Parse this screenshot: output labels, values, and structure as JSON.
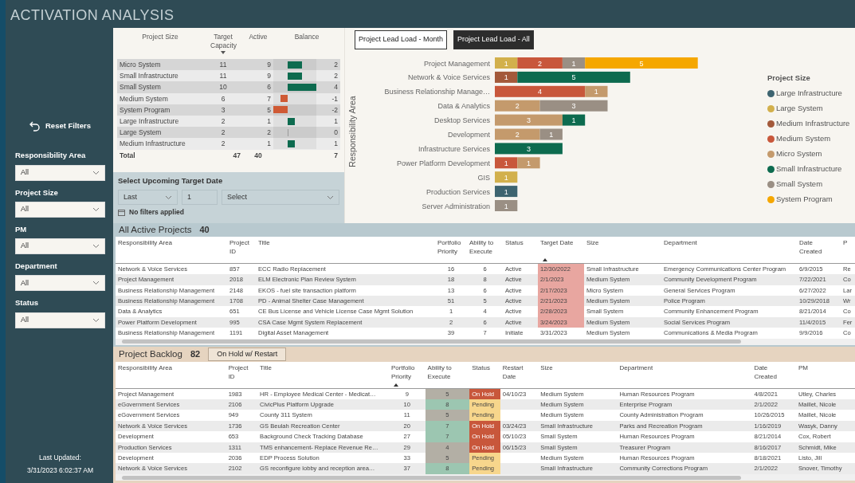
{
  "title": "ACTIVATION ANALYSIS",
  "sidebar": {
    "reset_label": "Reset Filters",
    "filters": [
      {
        "label": "Responsibility Area",
        "value": "All"
      },
      {
        "label": "Project Size",
        "value": "All"
      },
      {
        "label": "PM",
        "value": "All"
      },
      {
        "label": "Department",
        "value": "All"
      },
      {
        "label": "Status",
        "value": "All"
      }
    ],
    "last_updated_label": "Last Updated:",
    "last_updated": "3/31/2023 6:02:37 AM"
  },
  "capacity_table": {
    "columns": [
      {
        "label": "Project Size",
        "sorted": false
      },
      {
        "label": "Target Capacity",
        "sorted": true
      },
      {
        "label": "Active",
        "sorted": false
      },
      {
        "label": "Balance",
        "sorted": false
      }
    ],
    "rows": [
      {
        "size": "Micro System",
        "target": "11",
        "active": "9",
        "balance": "2",
        "kind": "surplus",
        "level": 0.5
      },
      {
        "size": "Small Infrastructure",
        "target": "11",
        "active": "9",
        "balance": "2",
        "kind": "surplus",
        "level": 0.5
      },
      {
        "size": "Small System",
        "target": "10",
        "active": "6",
        "balance": "4",
        "kind": "surplus",
        "level": 1
      },
      {
        "size": "Medium System",
        "target": "6",
        "active": "7",
        "balance": "-1",
        "kind": "deficit",
        "level": 0.5
      },
      {
        "size": "System Program",
        "target": "3",
        "active": "5",
        "balance": "-2",
        "kind": "deficit",
        "level": 1
      },
      {
        "size": "Large Infrastructure",
        "target": "2",
        "active": "1",
        "balance": "1",
        "kind": "surplus",
        "level": 0.25
      },
      {
        "size": "Large System",
        "target": "2",
        "active": "2",
        "balance": "0",
        "kind": "surplus",
        "level": 0
      },
      {
        "size": "Medium Infrastructure",
        "target": "2",
        "active": "1",
        "balance": "1",
        "kind": "surplus",
        "level": 0.25
      }
    ],
    "total": {
      "label": "Total",
      "target": "47",
      "active": "40",
      "balance": "7"
    }
  },
  "date_filter": {
    "title": "Select Upcoming Target Date",
    "period": "Last",
    "count": "1",
    "unit": "Select",
    "status": "No filters applied"
  },
  "chart_panel": {
    "tabs": [
      {
        "label": "Project Lead Load - Month",
        "selected": false
      },
      {
        "label": "Project Lead Load - All",
        "selected": true
      }
    ],
    "legend_title": "Project Size",
    "chart_data": {
      "type": "bar",
      "orientation": "horizontal",
      "stacked": true,
      "data_labels": true,
      "ylabel": "Responsibility Area",
      "categories": [
        "Project Management",
        "Network & Voice Services",
        "Business Relationship Manage…",
        "Data & Analytics",
        "Desktop Services",
        "Development",
        "Infrastructure Services",
        "Power Platform Development",
        "GIS",
        "Production Services",
        "Server Administration"
      ],
      "series": [
        {
          "name": "Large Infrastructure",
          "color": "#3d6470",
          "values": [
            null,
            null,
            null,
            null,
            null,
            null,
            null,
            null,
            null,
            1,
            null
          ]
        },
        {
          "name": "Large System",
          "color": "#d2b04c",
          "values": [
            1,
            null,
            null,
            null,
            null,
            null,
            null,
            null,
            1,
            null,
            null
          ]
        },
        {
          "name": "Medium Infrastructure",
          "color": "#a3593a",
          "values": [
            null,
            1,
            null,
            null,
            null,
            null,
            null,
            null,
            null,
            null,
            null
          ]
        },
        {
          "name": "Medium System",
          "color": "#c8573b",
          "values": [
            2,
            null,
            4,
            null,
            null,
            null,
            null,
            1,
            null,
            null,
            null
          ]
        },
        {
          "name": "Micro System",
          "color": "#c49a6c",
          "values": [
            null,
            null,
            1,
            2,
            3,
            2,
            null,
            1,
            null,
            null,
            null
          ]
        },
        {
          "name": "Small Infrastructure",
          "color": "#0d6b4f",
          "values": [
            null,
            5,
            null,
            null,
            1,
            null,
            3,
            null,
            null,
            null,
            null
          ]
        },
        {
          "name": "Small System",
          "color": "#9a8f84",
          "values": [
            1,
            null,
            null,
            3,
            null,
            1,
            null,
            null,
            null,
            null,
            1
          ]
        },
        {
          "name": "System Program",
          "color": "#f5a700",
          "values": [
            5,
            null,
            null,
            null,
            null,
            null,
            null,
            null,
            null,
            null,
            null
          ]
        }
      ]
    }
  },
  "active_projects": {
    "title": "All Active Projects",
    "count": "40",
    "columns": [
      {
        "label": "Responsibility Area",
        "sorted": false
      },
      {
        "label": "Project ID",
        "sorted": false
      },
      {
        "label": "Title",
        "sorted": false
      },
      {
        "label": "Portfolio Priority",
        "sorted": false
      },
      {
        "label": "Ability to Execute",
        "sorted": false
      },
      {
        "label": "Status",
        "sorted": false
      },
      {
        "label": "Target Date",
        "sorted": true
      },
      {
        "label": "Size",
        "sorted": false
      },
      {
        "label": "Department",
        "sorted": false
      },
      {
        "label": "Date Created",
        "sorted": false
      },
      {
        "label": "P",
        "sorted": false
      }
    ],
    "rows": [
      {
        "overdue": true,
        "cells": [
          "Network & Voice Services",
          "857",
          "ECC Radio Replacement",
          "16",
          "6",
          "Active",
          "12/30/2022",
          "Small Infrastructure",
          "Emergency Communications Center Program",
          "6/9/2015",
          "Re"
        ]
      },
      {
        "overdue": true,
        "cells": [
          "Project Management",
          "2018",
          "ELM Electronic Plan Review System",
          "18",
          "8",
          "Active",
          "2/1/2023",
          "Medium System",
          "Community Development Program",
          "7/22/2021",
          "Co"
        ]
      },
      {
        "overdue": true,
        "cells": [
          "Business Relationship Management",
          "2148",
          "EKOS - fuel site transaction platform",
          "13",
          "6",
          "Active",
          "2/17/2023",
          "Micro System",
          "General Services Program",
          "6/27/2022",
          "Lar"
        ]
      },
      {
        "overdue": true,
        "cells": [
          "Business Relationship Management",
          "1708",
          "PD - Animal Shelter Case Management",
          "51",
          "5",
          "Active",
          "2/21/2023",
          "Medium System",
          "Police Program",
          "10/29/2018",
          "Wr"
        ]
      },
      {
        "overdue": true,
        "cells": [
          "Data & Analytics",
          "651",
          "CE Bus License and Vehicle License Case Mgmt Solution",
          "1",
          "4",
          "Active",
          "2/28/2023",
          "Small System",
          "Community Enhancement Program",
          "8/21/2014",
          "Co"
        ]
      },
      {
        "overdue": true,
        "cells": [
          "Power Platform Development",
          "995",
          "CSA Case Mgmt System Replacement",
          "2",
          "6",
          "Active",
          "3/24/2023",
          "Medium System",
          "Social Services Program",
          "11/4/2015",
          "Fer"
        ]
      },
      {
        "overdue": false,
        "cells": [
          "Business Relationship Management",
          "1191",
          "Digital Asset Management",
          "39",
          "7",
          "Initiate",
          "3/31/2023",
          "Medium System",
          "Communications & Media Program",
          "9/9/2016",
          "Co"
        ]
      }
    ]
  },
  "backlog": {
    "title": "Project Backlog",
    "count": "82",
    "filter_button": "On Hold w/ Restart",
    "columns": [
      {
        "label": "Responsibility Area",
        "sorted": false
      },
      {
        "label": "Project ID",
        "sorted": false
      },
      {
        "label": "Title",
        "sorted": false
      },
      {
        "label": "Portfolio Priority",
        "sorted": true
      },
      {
        "label": "Ability to Execute",
        "sorted": false
      },
      {
        "label": "Status",
        "sorted": false
      },
      {
        "label": "Restart Date",
        "sorted": false
      },
      {
        "label": "Size",
        "sorted": false
      },
      {
        "label": "Department",
        "sorted": false
      },
      {
        "label": "Date Created",
        "sorted": false
      },
      {
        "label": "PM",
        "sorted": false
      }
    ],
    "rows": [
      {
        "cells": [
          "Project Management",
          "1983",
          "HR - Employee Medical Center - Medicat…",
          "9",
          {
            "text": "5",
            "color": "#b3afa5"
          },
          {
            "text": "On Hold",
            "color": "#c8573b"
          },
          "04/10/23",
          "Medium System",
          "Human Resources Program",
          "4/8/2021",
          "Utley, Charles"
        ]
      },
      {
        "cells": [
          "eGovernment Services",
          "2106",
          "CivicPlus Platform Upgrade",
          "10",
          {
            "text": "8",
            "color": "#9cc6b1"
          },
          {
            "text": "Pending",
            "color": "#f7d68c"
          },
          null,
          "Medium System",
          "Enterprise Program",
          "2/1/2022",
          "Maillet, Nicole"
        ]
      },
      {
        "cells": [
          "eGovernment Services",
          "949",
          "County 311 System",
          "11",
          {
            "text": "5",
            "color": "#b3afa5"
          },
          {
            "text": "Pending",
            "color": "#f7d68c"
          },
          null,
          "Medium System",
          "County Administration Program",
          "10/26/2015",
          "Maillet, Nicole"
        ]
      },
      {
        "cells": [
          "Network & Voice Services",
          "1736",
          "GS Beulah Recreation Center",
          "20",
          {
            "text": "7",
            "color": "#9cc6b1"
          },
          {
            "text": "On Hold",
            "color": "#c8573b"
          },
          "03/24/23",
          "Small Infrastructure",
          "Parks and Recreation Program",
          "1/16/2019",
          "Wasyk, Danny"
        ]
      },
      {
        "cells": [
          "Development",
          "653",
          "Background Check Tracking Database",
          "27",
          {
            "text": "7",
            "color": "#9cc6b1"
          },
          {
            "text": "On Hold",
            "color": "#c8573b"
          },
          "05/10/23",
          "Small System",
          "Human Resources Program",
          "8/21/2014",
          "Cox, Robert"
        ]
      },
      {
        "cells": [
          "Production Services",
          "1311",
          "TMS enhancement- Replace Revenue Re…",
          "29",
          {
            "text": "4",
            "color": "#b3afa5"
          },
          {
            "text": "On Hold",
            "color": "#c8573b"
          },
          "06/15/23",
          "Small System",
          "Treasurer Program",
          "8/16/2017",
          "Schmidt, Mike"
        ]
      },
      {
        "cells": [
          "Development",
          "2036",
          "EDP Process Solution",
          "33",
          {
            "text": "5",
            "color": "#b3afa5"
          },
          {
            "text": "Pending",
            "color": "#f7d68c"
          },
          null,
          "Medium System",
          "Human Resources Program",
          "8/18/2021",
          "Listo, Jill"
        ]
      },
      {
        "cells": [
          "Network & Voice Services",
          "2102",
          "GS reconfigure lobby and reception area…",
          "37",
          {
            "text": "8",
            "color": "#9cc6b1"
          },
          {
            "text": "Pending",
            "color": "#f7d68c"
          },
          null,
          "Small Infrastructure",
          "Community Corrections Program",
          "2/1/2022",
          "Snover, Timothy"
        ]
      }
    ]
  }
}
